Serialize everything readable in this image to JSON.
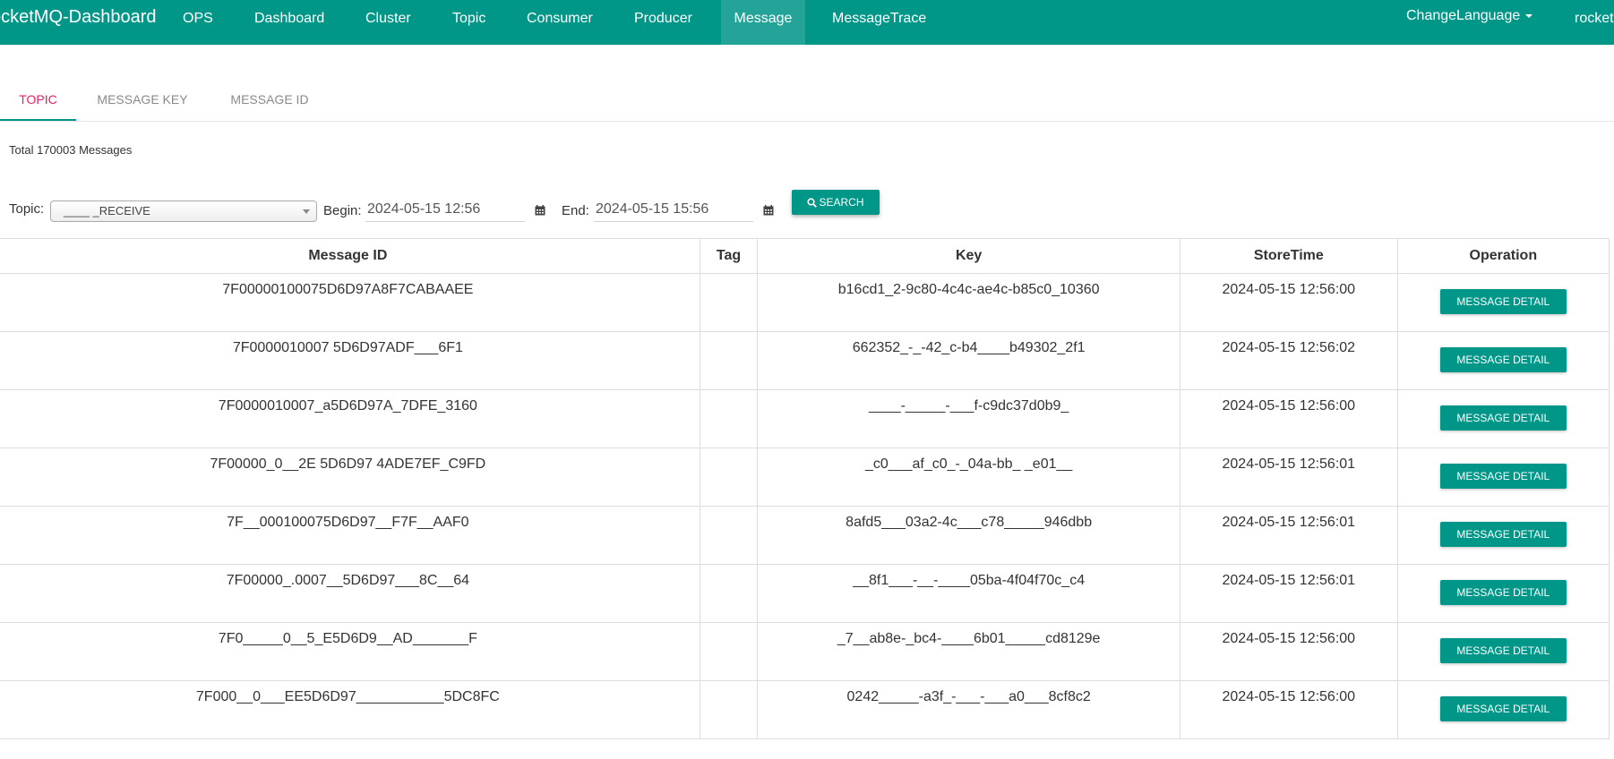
{
  "navbar": {
    "brand": "ocketMQ-Dashboard",
    "items": [
      "OPS",
      "Dashboard",
      "Cluster",
      "Topic",
      "Consumer",
      "Producer",
      "Message",
      "MessageTrace"
    ],
    "change_language": "ChangeLanguage",
    "user": "rocket",
    "accent_color": "#009688"
  },
  "tabs": [
    "TOPIC",
    "MESSAGE KEY",
    "MESSAGE ID"
  ],
  "summary": {
    "total": "Total 170003 Messages"
  },
  "search": {
    "topic_label": "Topic:",
    "topic_value": "____ _RECEIVE",
    "begin_label": "Begin:",
    "begin_value": "2024-05-15 12:56",
    "end_label": "End:",
    "end_value": "2024-05-15 15:56",
    "button_label": "SEARCH",
    "button_icon": "search-icon",
    "calendar_icon": "calendar-icon"
  },
  "table": {
    "columns": [
      "Message ID",
      "Tag",
      "Key",
      "StoreTime",
      "Operation"
    ],
    "detail_label": "MESSAGE DETAIL",
    "rows": [
      {
        "message_id": "7F00000100075D6D97A8F7CABAAEE",
        "tag": "",
        "key": "b16cd1_2-9c80-4c4c-ae4c-b85c0_10360",
        "store_time": "2024-05-15 12:56:00"
      },
      {
        "message_id": "7F0000010007 5D6D97ADF___6F1",
        "tag": "",
        "key": "662352_-_-42_c-b4____b49302_2f1",
        "store_time": "2024-05-15 12:56:02"
      },
      {
        "message_id": "7F0000010007_a5D6D97A_7DFE_3160",
        "tag": "",
        "key": "____-_____-___f-c9dc37d0b9_",
        "store_time": "2024-05-15 12:56:00"
      },
      {
        "message_id": "7F00000_0__2E 5D6D97 4ADE7EF_C9FD",
        "tag": "",
        "key": "_c0___af_c0_-_04a-bb_ _e01__",
        "store_time": "2024-05-15 12:56:01"
      },
      {
        "message_id": "7F__000100075D6D97__F7F__AAF0",
        "tag": "",
        "key": "8afd5___03a2-4c___c78_____946dbb",
        "store_time": "2024-05-15 12:56:01"
      },
      {
        "message_id": "7F00000_.0007__5D6D97___8C__64",
        "tag": "",
        "key": "__8f1___-__-____05ba-4f04f70c_c4",
        "store_time": "2024-05-15 12:56:01"
      },
      {
        "message_id": "7F0_____0__5_E5D6D9__AD_______F",
        "tag": "",
        "key": "_7__ab8e-_bc4-____6b01_____cd8129e",
        "store_time": "2024-05-15 12:56:00"
      },
      {
        "message_id": "7F000__0___EE5D6D97___________5DC8FC",
        "tag": "",
        "key": "0242_____-a3f_-___-___a0___8cf8c2",
        "store_time": "2024-05-15 12:56:00"
      }
    ]
  }
}
